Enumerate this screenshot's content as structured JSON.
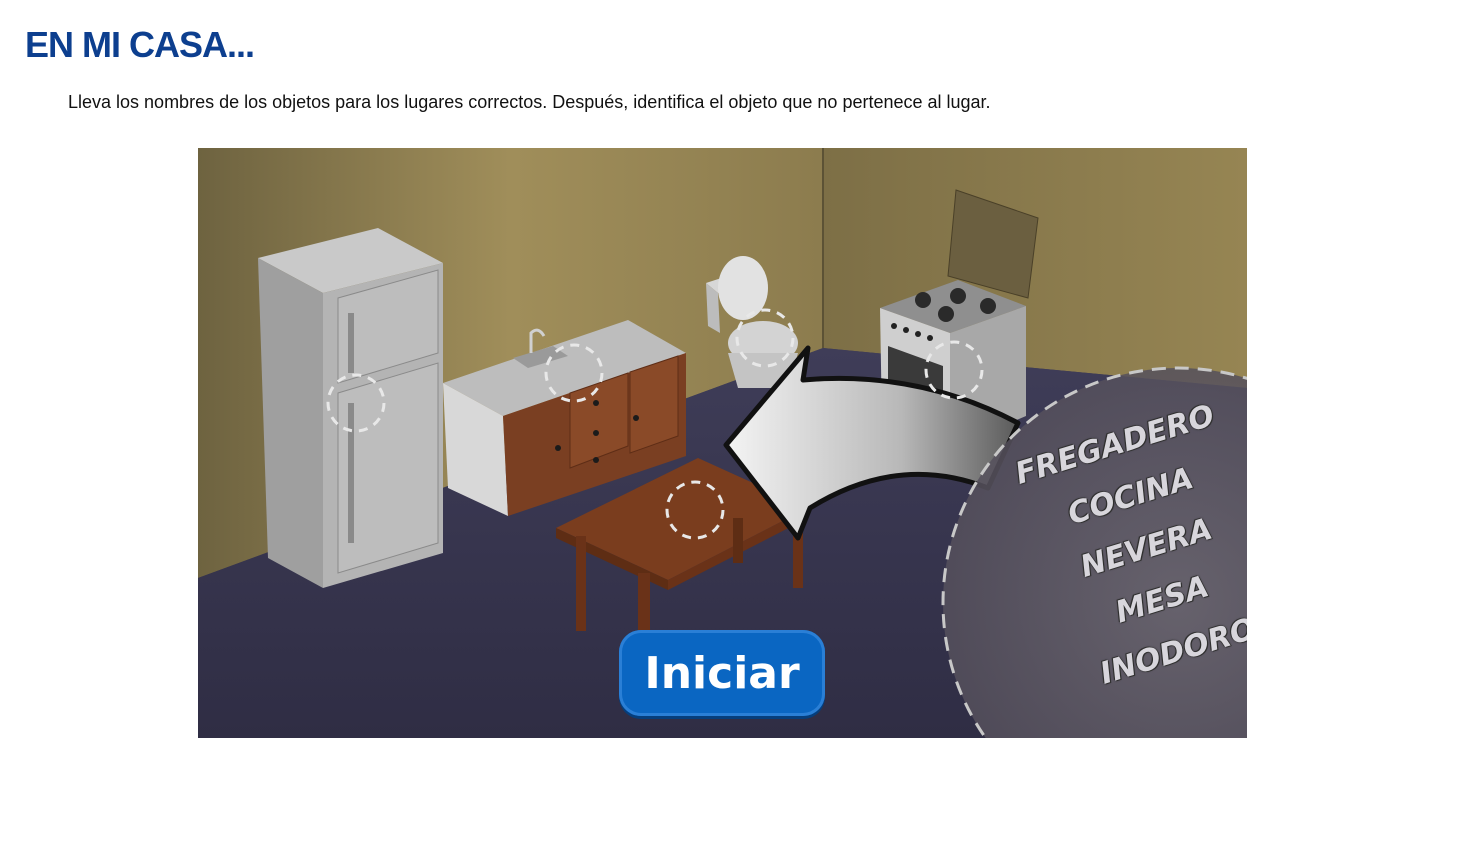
{
  "header": {
    "title": "EN MI CASA...",
    "instructions": "Lleva los nombres de los objetos para los lugares correctos. Después, identifica el objeto que no pertenece al lugar."
  },
  "activity": {
    "start_button": "Iniciar",
    "words": [
      "FREGADERO",
      "COCINA",
      "NEVERA",
      "MESA",
      "INODORO"
    ],
    "drop_targets": [
      "fridge",
      "sink",
      "toilet",
      "stove",
      "table"
    ]
  },
  "colors": {
    "title": "#0d3f8f",
    "button": "#0a66c2",
    "wall": "#8b7a4c",
    "floor": "#3d3b55"
  }
}
